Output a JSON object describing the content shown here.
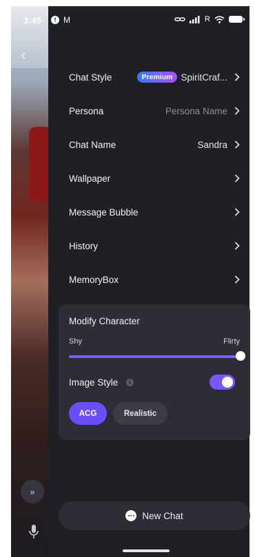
{
  "status_bar": {
    "time": "3:45",
    "notification_glyph": "!",
    "mail_glyph": "M",
    "carrier_text": "R"
  },
  "menu": [
    {
      "key": "chat-style",
      "label": "Chat Style",
      "badge": "Premium",
      "value": "SpiritCraf..."
    },
    {
      "key": "persona",
      "label": "Persona",
      "value": "Persona Name"
    },
    {
      "key": "chat-name",
      "label": "Chat Name",
      "value": "Sandra"
    },
    {
      "key": "wallpaper",
      "label": "Wallpaper",
      "value": ""
    },
    {
      "key": "message-bubble",
      "label": "Message Bubble",
      "value": ""
    },
    {
      "key": "history",
      "label": "History",
      "value": ""
    },
    {
      "key": "memorybox",
      "label": "MemoryBox",
      "value": ""
    }
  ],
  "modify_character": {
    "title": "Modify Character",
    "slider": {
      "min_label": "Shy",
      "max_label": "Flirty",
      "value_fraction": 1.0
    },
    "image_style": {
      "label": "Image Style",
      "enabled": true,
      "options": [
        "ACG",
        "Realistic"
      ],
      "selected": "ACG"
    }
  },
  "new_chat": {
    "label": "New Chat"
  },
  "colors": {
    "panel_bg": "#1f2026",
    "card_bg": "#2c2d35",
    "accent": "#7a55ff",
    "premium_gradient_start": "#2f7bff",
    "premium_gradient_end": "#b04cff"
  },
  "icons": [
    "back-chevron-icon",
    "fast-forward-icon",
    "microphone-icon",
    "chevron-right-icon",
    "info-icon",
    "chat-bubble-icon",
    "battery-icon",
    "wifi-icon",
    "signal-icon"
  ]
}
